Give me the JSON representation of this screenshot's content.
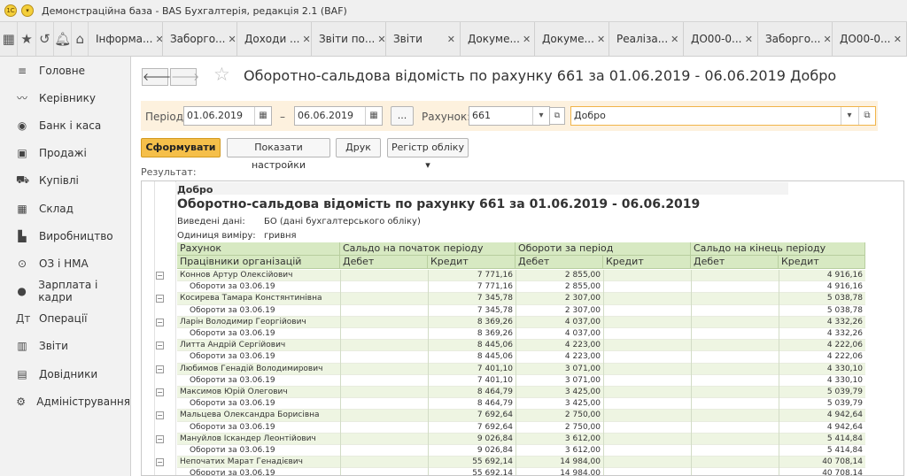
{
  "window": {
    "title": "Демонстраційна база - BAS Бухгалтерія, редакція 2.1  (BAF)"
  },
  "tabs": [
    {
      "label": "Інформа..."
    },
    {
      "label": "Заборго..."
    },
    {
      "label": "Доходи ..."
    },
    {
      "label": "Звіти по..."
    },
    {
      "label": "Звіти"
    },
    {
      "label": "Докуме..."
    },
    {
      "label": "Докуме..."
    },
    {
      "label": "Реаліза..."
    },
    {
      "label": "ДО00-0..."
    },
    {
      "label": "Заборго..."
    },
    {
      "label": "ДО00-0..."
    }
  ],
  "sidebar": {
    "items": [
      {
        "label": "Головне",
        "icon": "≡"
      },
      {
        "label": "Керівнику",
        "icon": "〰"
      },
      {
        "label": "Банк і каса",
        "icon": "◉"
      },
      {
        "label": "Продажі",
        "icon": "▣"
      },
      {
        "label": "Купівлі",
        "icon": "⛟"
      },
      {
        "label": "Склад",
        "icon": "▦"
      },
      {
        "label": "Виробництво",
        "icon": "▙"
      },
      {
        "label": "ОЗ і НМА",
        "icon": "⊙"
      },
      {
        "label": "Зарплата і кадри",
        "icon": "●"
      },
      {
        "label": "Операції",
        "icon": "Дт"
      },
      {
        "label": "Звіти",
        "icon": "▥"
      },
      {
        "label": "Довідники",
        "icon": "▤"
      },
      {
        "label": "Адміністрування",
        "icon": "⚙"
      }
    ]
  },
  "report": {
    "title": "Оборотно-сальдова відомість по рахунку 661 за 01.06.2019 - 06.06.2019 Добро"
  },
  "filters": {
    "period_label": "Період:",
    "date_from": "01.06.2019",
    "dash": "–",
    "date_to": "06.06.2019",
    "dots": "...",
    "account_label": "Рахунок:",
    "account": "661",
    "organization": "Добро"
  },
  "actions": {
    "generate": "Сформувати",
    "show_settings": "Показати настройки",
    "print": "Друк",
    "register": "Регістр обліку"
  },
  "result_label": "Результат:",
  "sheet": {
    "organization": "Добро",
    "title": "Оборотно-сальдова відомість по рахунку 661 за 01.06.2019 - 06.06.2019",
    "meta": [
      {
        "label": "Виведені дані:",
        "value": "БО (дані бухгалтерського обліку)"
      },
      {
        "label": "Одиниця виміру:",
        "value": "гривня"
      }
    ],
    "headers": {
      "account": "Рахунок",
      "employees": "Працівники організацій",
      "opening": "Сальдо на початок періоду",
      "turnover": "Обороти за період",
      "closing": "Сальдо на кінець періоду",
      "debit": "Дебет",
      "credit": "Кредит"
    },
    "rows": [
      {
        "name": "Коннов Артур Олексійович",
        "open_cr": "7 771,16",
        "turn_dt": "2 855,00",
        "close_cr": "4 916,16"
      },
      {
        "name": "Обороти за 03.06.19",
        "sub": true,
        "open_cr": "7 771,16",
        "turn_dt": "2 855,00",
        "close_cr": "4 916,16"
      },
      {
        "name": "Косирева Тамара Констянтинівна",
        "open_cr": "7 345,78",
        "turn_dt": "2 307,00",
        "close_cr": "5 038,78"
      },
      {
        "name": "Обороти за 03.06.19",
        "sub": true,
        "open_cr": "7 345,78",
        "turn_dt": "2 307,00",
        "close_cr": "5 038,78"
      },
      {
        "name": "Ларін Володимир Георгійович",
        "open_cr": "8 369,26",
        "turn_dt": "4 037,00",
        "close_cr": "4 332,26"
      },
      {
        "name": "Обороти за 03.06.19",
        "sub": true,
        "open_cr": "8 369,26",
        "turn_dt": "4 037,00",
        "close_cr": "4 332,26"
      },
      {
        "name": "Литта Андрій Сергійович",
        "open_cr": "8 445,06",
        "turn_dt": "4 223,00",
        "close_cr": "4 222,06"
      },
      {
        "name": "Обороти за 03.06.19",
        "sub": true,
        "open_cr": "8 445,06",
        "turn_dt": "4 223,00",
        "close_cr": "4 222,06"
      },
      {
        "name": "Любимов Генадій Володимирович",
        "open_cr": "7 401,10",
        "turn_dt": "3 071,00",
        "close_cr": "4 330,10"
      },
      {
        "name": "Обороти за 03.06.19",
        "sub": true,
        "open_cr": "7 401,10",
        "turn_dt": "3 071,00",
        "close_cr": "4 330,10"
      },
      {
        "name": "Максимов Юрій Олегович",
        "open_cr": "8 464,79",
        "turn_dt": "3 425,00",
        "close_cr": "5 039,79"
      },
      {
        "name": "Обороти за 03.06.19",
        "sub": true,
        "open_cr": "8 464,79",
        "turn_dt": "3 425,00",
        "close_cr": "5 039,79"
      },
      {
        "name": "Мальцева Олександра Борисівна",
        "open_cr": "7 692,64",
        "turn_dt": "2 750,00",
        "close_cr": "4 942,64"
      },
      {
        "name": "Обороти за 03.06.19",
        "sub": true,
        "open_cr": "7 692,64",
        "turn_dt": "2 750,00",
        "close_cr": "4 942,64"
      },
      {
        "name": "Мануйлов Іскандер Леонтійович",
        "open_cr": "9 026,84",
        "turn_dt": "3 612,00",
        "close_cr": "5 414,84"
      },
      {
        "name": "Обороти за 03.06.19",
        "sub": true,
        "open_cr": "9 026,84",
        "turn_dt": "3 612,00",
        "close_cr": "5 414,84"
      },
      {
        "name": "Непочатих Марат Генадієвич",
        "open_cr": "55 692,14",
        "turn_dt": "14 984,00",
        "close_cr": "40 708,14"
      },
      {
        "name": "Обороти за 03.06.19",
        "sub": true,
        "open_cr": "55 692,14",
        "turn_dt": "14 984,00",
        "close_cr": "40 708,14"
      }
    ]
  }
}
